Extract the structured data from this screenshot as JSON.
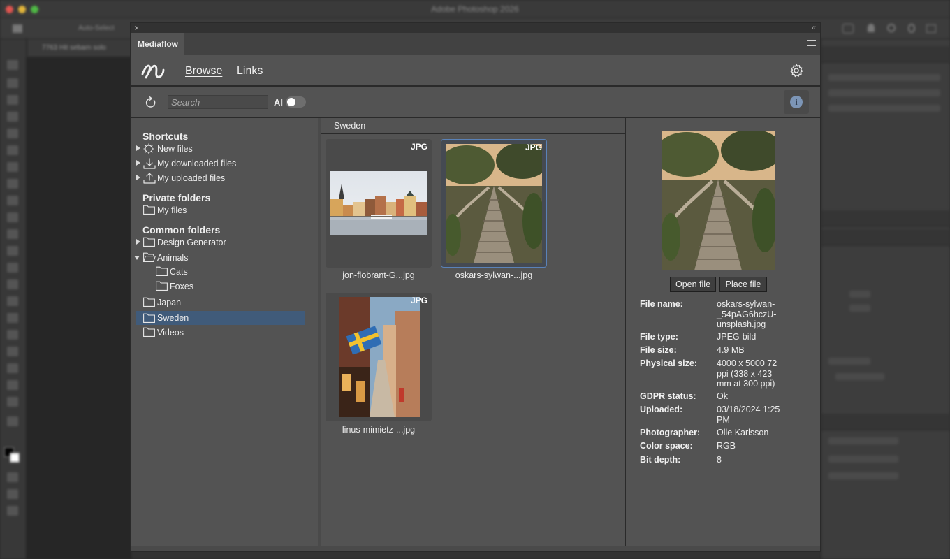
{
  "photoshop": {
    "app_title": "Adobe Photoshop 2026",
    "option_label": "Auto-Select",
    "doc_tab": "7763 Hit sebarn solo"
  },
  "panel": {
    "tab_title": "Mediaflow",
    "collapse_glyph": "«",
    "close_glyph": "×"
  },
  "header": {
    "nav": [
      "Browse",
      "Links"
    ]
  },
  "toolbar": {
    "search_placeholder": "Search",
    "ai_label": "AI",
    "ai_enabled": false,
    "info_glyph": "i"
  },
  "sidebar": {
    "shortcuts_heading": "Shortcuts",
    "shortcuts": [
      {
        "label": "New files",
        "icon": "sparkle-icon"
      },
      {
        "label": "My downloaded files",
        "icon": "download-icon"
      },
      {
        "label": "My uploaded files",
        "icon": "upload-icon"
      }
    ],
    "private_heading": "Private folders",
    "private": [
      {
        "label": "My files"
      }
    ],
    "common_heading": "Common folders",
    "common": [
      {
        "label": "Design Generator",
        "expandable": true
      },
      {
        "label": "Animals",
        "expanded": true
      },
      {
        "label": "Cats"
      },
      {
        "label": "Foxes"
      },
      {
        "label": "Japan"
      },
      {
        "label": "Sweden",
        "selected": true
      },
      {
        "label": "Videos"
      }
    ]
  },
  "browser": {
    "folder_title": "Sweden",
    "files": [
      {
        "name": "jon-flobrant-G...jpg",
        "type": "JPG"
      },
      {
        "name": "oskars-sylwan-...jpg",
        "type": "JPG",
        "selected": true
      },
      {
        "name": "linus-mimietz-...jpg",
        "type": "JPG"
      }
    ]
  },
  "detail": {
    "buttons": {
      "open": "Open file",
      "place": "Place file"
    },
    "meta": [
      {
        "key": "File name:",
        "value": "oskars-sylwan-\n_54pAG6hczU-\nunsplash.jpg"
      },
      {
        "key": "File type:",
        "value": "JPEG-bild"
      },
      {
        "key": "File size:",
        "value": "4.9 MB"
      },
      {
        "key": "Physical size:",
        "value": "4000 x 5000 72\nppi (338 x 423\nmm at 300 ppi)"
      },
      {
        "key": "GDPR status:",
        "value": "Ok"
      },
      {
        "key": "Uploaded:",
        "value": "03/18/2024 1:25\nPM"
      },
      {
        "key": "Photographer:",
        "value": "Olle Karlsson"
      },
      {
        "key": "Color space:",
        "value": "RGB"
      },
      {
        "key": "Bit depth:",
        "value": "8"
      }
    ]
  },
  "colors": {
    "panel_bg": "#535353",
    "selection": "#405b7a",
    "accent_border": "#5a82b8"
  }
}
